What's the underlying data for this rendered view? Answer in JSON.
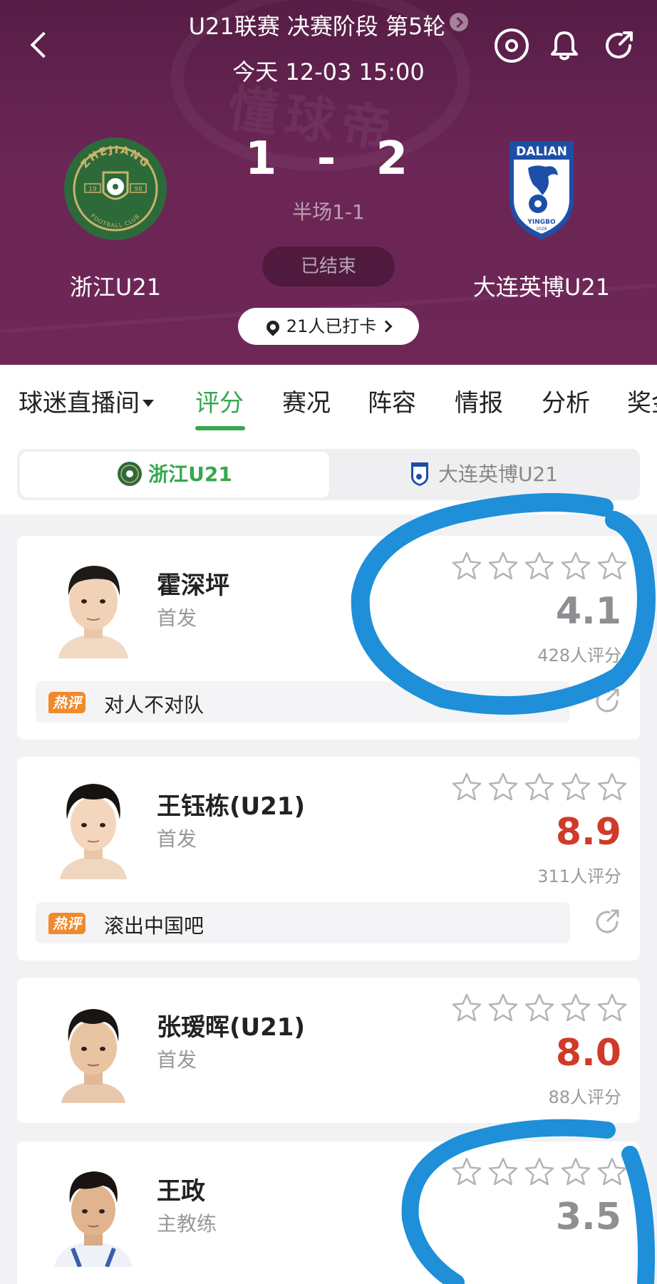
{
  "header": {
    "league_round": "U21联赛 决赛阶段 第5轮",
    "match_time": "今天 12-03 15:00",
    "home_team": "浙江U21",
    "away_team": "大连英博U21",
    "home_score": "1",
    "away_score": "2",
    "score_sep": "-",
    "halftime": "半场1-1",
    "status": "已结束",
    "checkin": "21人已打卡",
    "watermark": "懂球帝",
    "home_logo": {
      "top_text": "ZHEJIANG",
      "bottom_text": "FOOTBALL CLUB",
      "year_left": "19",
      "year_right": "98",
      "color": "#2d6a3a"
    },
    "away_logo": {
      "top_text": "DALIAN",
      "bottom_text": "YINGBO",
      "year": "2028",
      "color": "#1d4fa8"
    }
  },
  "tabs": [
    {
      "label": "球迷直播间",
      "active": false
    },
    {
      "label": "评分",
      "active": true
    },
    {
      "label": "赛况",
      "active": false
    },
    {
      "label": "阵容",
      "active": false
    },
    {
      "label": "情报",
      "active": false
    },
    {
      "label": "分析",
      "active": false
    },
    {
      "label": "奖金",
      "active": false
    }
  ],
  "team_switch": {
    "selected": "浙江U21",
    "other": "大连英博U21"
  },
  "players": [
    {
      "name": "霍深坪",
      "role": "首发",
      "rating": "4.1",
      "raters": "428人评分",
      "stars": 0,
      "hot_label": "热评",
      "comment": "对人不对队"
    },
    {
      "name": "王钰栋(U21)",
      "role": "首发",
      "rating": "8.9",
      "raters": "311人评分",
      "stars": 0,
      "hot_label": "热评",
      "comment": "滚出中国吧"
    },
    {
      "name": "张瑷晖(U21)",
      "role": "首发",
      "rating": "8.0",
      "raters": "88人评分",
      "stars": 0
    },
    {
      "name": "王政",
      "role": "主教练",
      "rating": "3.5",
      "stars": 0
    }
  ],
  "colors": {
    "accent_green": "#34a84f",
    "header_purple": "#6b2656",
    "rating_high": "#d03a2b",
    "rating_low": "#8f8f93",
    "annotation_blue": "#1e8fd8"
  }
}
